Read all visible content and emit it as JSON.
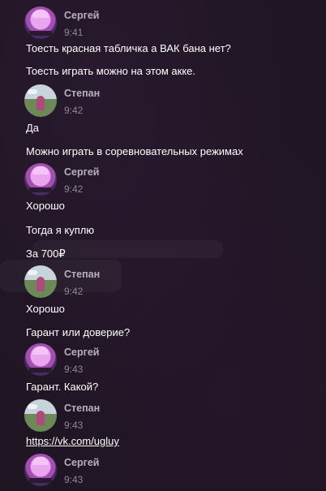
{
  "messages": [
    {
      "author": "Сергей",
      "time": "9:41",
      "avatar": "sergey-avatar",
      "lines": [
        "Тоесть красная табличка а ВАК бана нет?",
        "Тоесть играть можно на этом акке."
      ]
    },
    {
      "author": "Степан",
      "time": "9:42",
      "avatar": "stepan-avatar",
      "lines": [
        "Да",
        "Можно играть в соревновательных режимах"
      ]
    },
    {
      "author": "Сергей",
      "time": "9:42",
      "avatar": "sergey-avatar",
      "lines": [
        "Хорошо",
        "Тогда я куплю",
        "За 700₽"
      ]
    },
    {
      "author": "Степан",
      "time": "9:42",
      "avatar": "stepan-avatar",
      "lines": [
        "Хорошо",
        "Гарант или доверие?"
      ]
    },
    {
      "author": "Сергей",
      "time": "9:43",
      "avatar": "sergey-avatar",
      "lines": [
        "Гарант. Какой?"
      ]
    },
    {
      "author": "Степан",
      "time": "9:43",
      "avatar": "stepan-avatar",
      "lines": [
        "https://vk.com/ugluy"
      ]
    },
    {
      "author": "Сергей",
      "time": "9:43",
      "avatar": "sergey-avatar",
      "lines": []
    }
  ],
  "colors": {
    "background": "#1f1523",
    "author_name": "#b7b0bc",
    "timestamp": "#8f8696",
    "message_text": "#ffffff"
  }
}
